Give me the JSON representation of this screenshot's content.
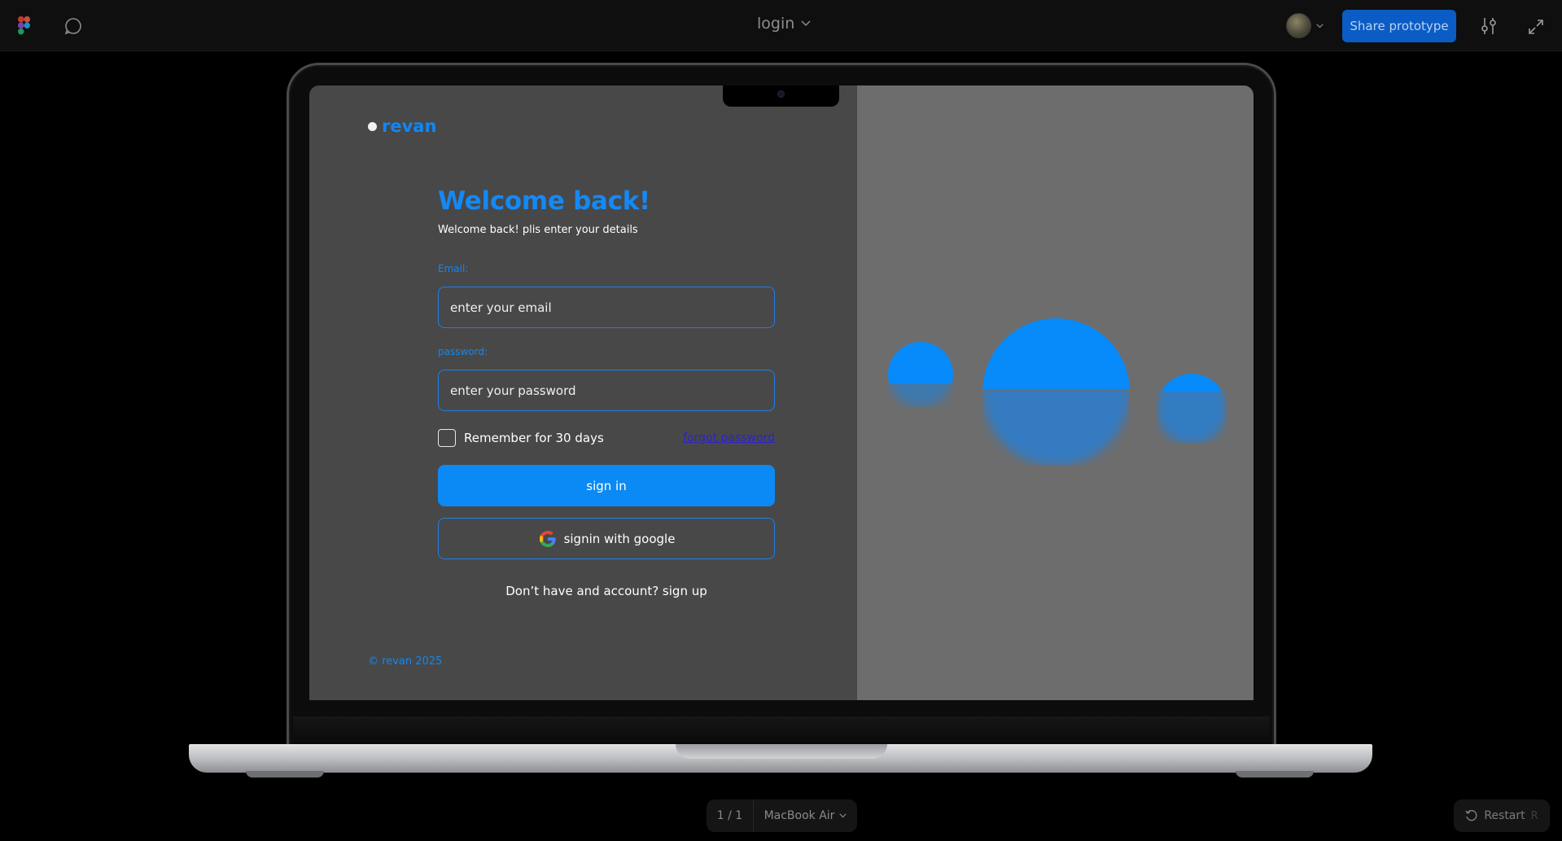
{
  "toolbar": {
    "file_title": "login",
    "share_label": "Share prototype"
  },
  "login": {
    "brand": "revan",
    "title": "Welcome back!",
    "subtitle": "Welcome back! plis enter your details",
    "email_label": "Email:",
    "email_placeholder": "enter your email",
    "password_label": "password:",
    "password_placeholder": "enter your password",
    "remember_label": "Remember for 30 days",
    "forgot_label": "forgot password",
    "signin_label": "sign in",
    "google_label": "signin with google",
    "signup_text": "Don’t have and account? sign up",
    "copyright": "© revan 2025"
  },
  "bottom": {
    "page_count": "1 / 1",
    "device": "MacBook Air",
    "restart_label": "Restart",
    "restart_key": "R"
  },
  "colors": {
    "accent": "#0b8af5",
    "share_button": "#0b5cc4",
    "left_panel": "#484848",
    "right_panel": "#6d6d6d",
    "forgot_link": "#2a25c8"
  },
  "icons": [
    "figma-logo-icon",
    "comment-icon",
    "chevron-down-icon",
    "settings-icon",
    "expand-icon",
    "google-icon",
    "restart-icon"
  ]
}
